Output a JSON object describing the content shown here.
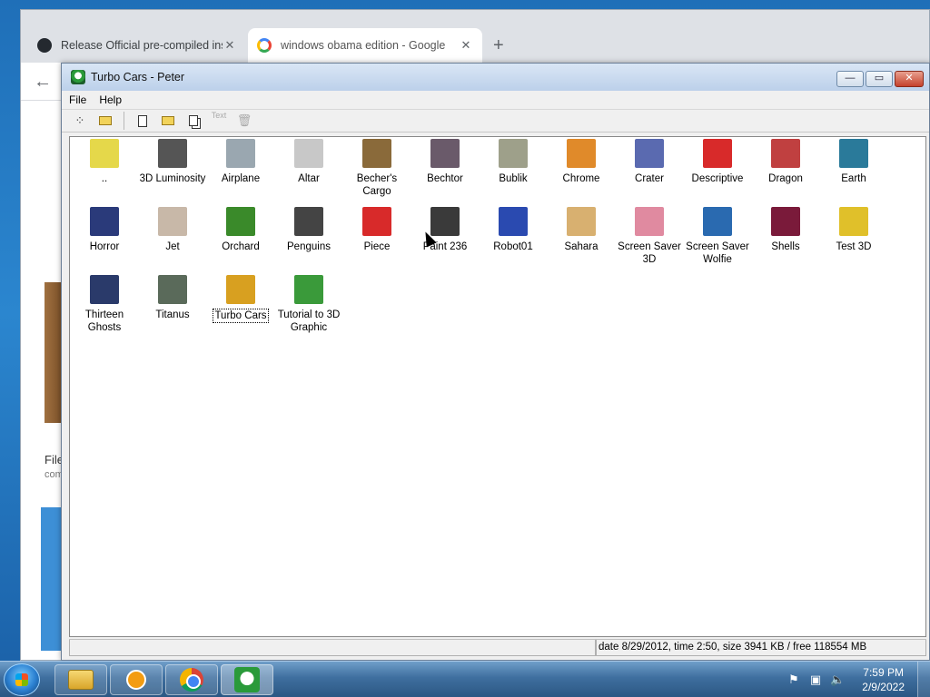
{
  "browser": {
    "tabs": [
      {
        "title": "Release Official pre-compiled ins",
        "close": "✕"
      },
      {
        "title": "windows obama edition - Google",
        "close": "✕"
      }
    ],
    "new_tab": "+",
    "back": "←",
    "bg_text1": "File",
    "bg_text2": "com"
  },
  "app": {
    "title": "Turbo Cars - Peter",
    "controls": {
      "minimize": "—",
      "maximize": "▭",
      "close": "✕"
    },
    "menu": [
      "File",
      "Help"
    ],
    "toolbar": {
      "disabled_label": "Text"
    },
    "items": [
      {
        "label": "..",
        "color": "#e5d84a"
      },
      {
        "label": "3D Luminosity",
        "color": "#555555"
      },
      {
        "label": "Airplane",
        "color": "#9aa7b0"
      },
      {
        "label": "Altar",
        "color": "#c8c8c8"
      },
      {
        "label": "Becher's Cargo",
        "color": "#8a6a3a"
      },
      {
        "label": "Bechtor",
        "color": "#6a5a6a"
      },
      {
        "label": "Bublik",
        "color": "#9ea08a"
      },
      {
        "label": "Chrome",
        "color": "#e08a2a"
      },
      {
        "label": "Crater",
        "color": "#5a6ab0"
      },
      {
        "label": "Descriptive",
        "color": "#d82a2a"
      },
      {
        "label": "Dragon",
        "color": "#c04040"
      },
      {
        "label": "Earth",
        "color": "#2a7a9a"
      },
      {
        "label": "Horror",
        "color": "#2a3a7a"
      },
      {
        "label": "Jet",
        "color": "#c8b8a8"
      },
      {
        "label": "Orchard",
        "color": "#3a8a2a"
      },
      {
        "label": "Penguins",
        "color": "#444444"
      },
      {
        "label": "Piece",
        "color": "#d82a2a"
      },
      {
        "label": "Paint 236",
        "color": "#3a3a3a"
      },
      {
        "label": "Robot01",
        "color": "#2a4ab0"
      },
      {
        "label": "Sahara",
        "color": "#d8b070"
      },
      {
        "label": "Screen Saver 3D",
        "color": "#e08aa0"
      },
      {
        "label": "Screen Saver Wolfie",
        "color": "#2a6ab0"
      },
      {
        "label": "Shells",
        "color": "#7a1a3a"
      },
      {
        "label": "Test 3D",
        "color": "#e0c02a"
      },
      {
        "label": "Thirteen Ghosts",
        "color": "#2a3a6a"
      },
      {
        "label": "Titanus",
        "color": "#5a6a5a"
      },
      {
        "label": "Turbo Cars",
        "color": "#d8a020"
      },
      {
        "label": "Tutorial to 3D Graphic",
        "color": "#3a9a3a"
      }
    ],
    "selected_item": "Turbo Cars",
    "status": "date 8/29/2012, time 2:50, size 3941 KB / free 118554 MB"
  },
  "taskbar": {
    "clock_time": "7:59 PM",
    "clock_date": "2/9/2022"
  }
}
